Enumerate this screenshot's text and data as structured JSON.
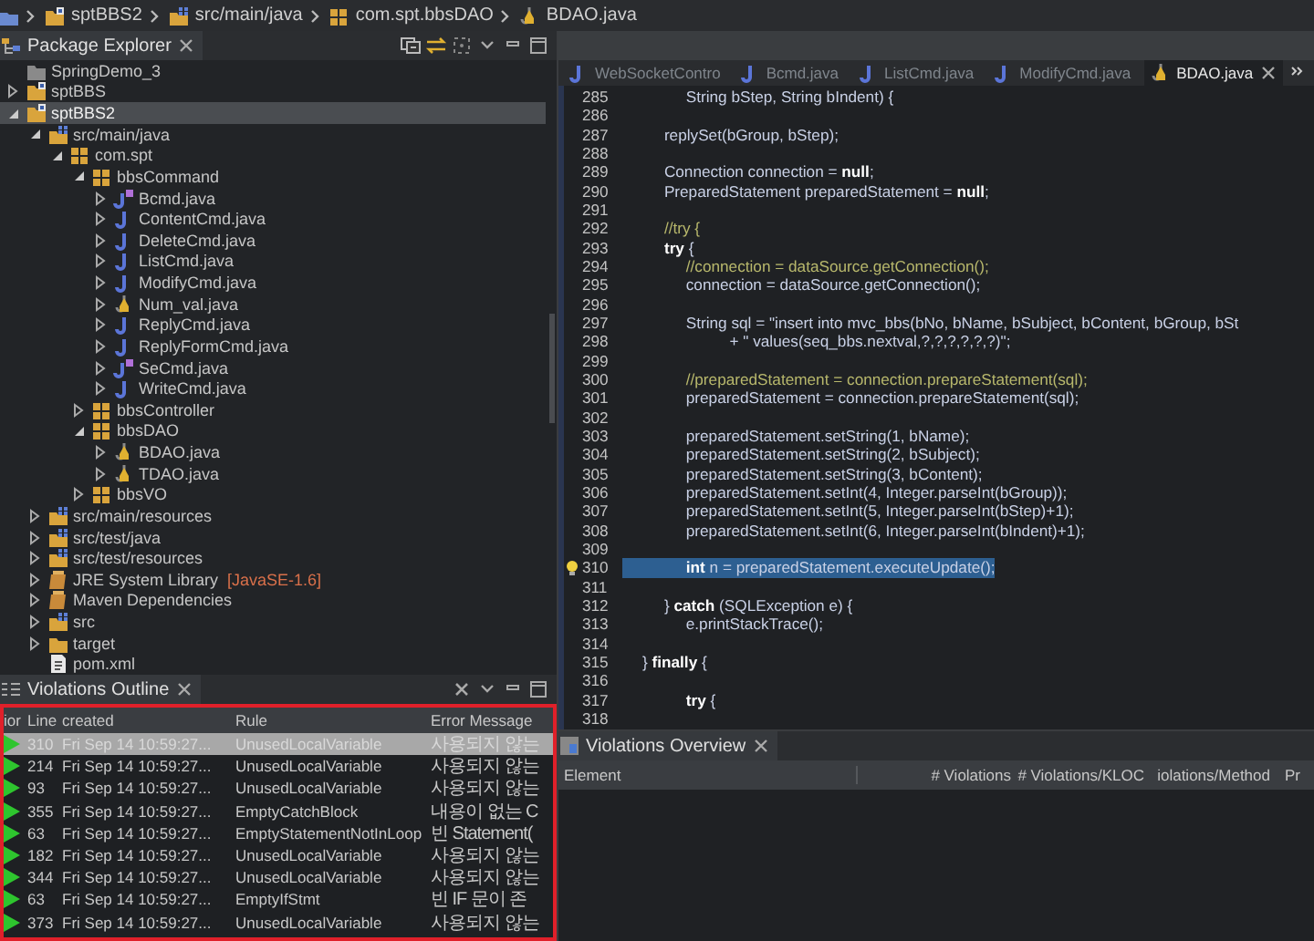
{
  "breadcrumb": [
    {
      "label": "sptBBS2",
      "kind": "project"
    },
    {
      "label": "src/main/java",
      "kind": "source-folder"
    },
    {
      "label": "com.spt.bbsDAO",
      "kind": "package"
    },
    {
      "label": "BDAO.java",
      "kind": "java-warning"
    }
  ],
  "package_explorer": {
    "title": "Package Explorer",
    "tree": [
      {
        "label": "SpringDemo_3",
        "kind": "closed-project",
        "selected": false
      },
      {
        "label": "sptBBS",
        "kind": "project",
        "expanded": false,
        "selected": false
      },
      {
        "label": "sptBBS2",
        "kind": "project",
        "expanded": true,
        "selected": true,
        "children": [
          {
            "label": "src/main/java",
            "kind": "source-folder",
            "expanded": true,
            "selected": false,
            "children": [
              {
                "label": "com.spt",
                "kind": "package",
                "expanded": true,
                "selected": false,
                "children": [
                  {
                    "label": "bbsCommand",
                    "kind": "package",
                    "expanded": true,
                    "selected": false,
                    "children": [
                      {
                        "label": "Bcmd.java",
                        "kind": "java-interface",
                        "expanded": false,
                        "selected": false
                      },
                      {
                        "label": "ContentCmd.java",
                        "kind": "java",
                        "expanded": false,
                        "selected": false
                      },
                      {
                        "label": "DeleteCmd.java",
                        "kind": "java",
                        "expanded": false,
                        "selected": false
                      },
                      {
                        "label": "ListCmd.java",
                        "kind": "java",
                        "expanded": false,
                        "selected": false
                      },
                      {
                        "label": "ModifyCmd.java",
                        "kind": "java",
                        "expanded": false,
                        "selected": false
                      },
                      {
                        "label": "Num_val.java",
                        "kind": "java-warning",
                        "expanded": false,
                        "selected": false
                      },
                      {
                        "label": "ReplyCmd.java",
                        "kind": "java",
                        "expanded": false,
                        "selected": false
                      },
                      {
                        "label": "ReplyFormCmd.java",
                        "kind": "java",
                        "expanded": false,
                        "selected": false
                      },
                      {
                        "label": "SeCmd.java",
                        "kind": "java-interface",
                        "expanded": false,
                        "selected": false
                      },
                      {
                        "label": "WriteCmd.java",
                        "kind": "java",
                        "expanded": false,
                        "selected": false
                      }
                    ]
                  },
                  {
                    "label": "bbsController",
                    "kind": "package",
                    "expanded": false,
                    "selected": false
                  },
                  {
                    "label": "bbsDAO",
                    "kind": "package",
                    "expanded": true,
                    "selected": false,
                    "children": [
                      {
                        "label": "BDAO.java",
                        "kind": "java-warning",
                        "expanded": false,
                        "selected": false
                      },
                      {
                        "label": "TDAO.java",
                        "kind": "java-warning",
                        "expanded": false,
                        "selected": false
                      }
                    ]
                  },
                  {
                    "label": "bbsVO",
                    "kind": "package",
                    "expanded": false,
                    "selected": false
                  }
                ]
              }
            ]
          },
          {
            "label": "src/main/resources",
            "kind": "source-folder",
            "expanded": false,
            "selected": false
          },
          {
            "label": "src/test/java",
            "kind": "source-folder",
            "expanded": false,
            "selected": false
          },
          {
            "label": "src/test/resources",
            "kind": "source-folder",
            "expanded": false,
            "selected": false
          },
          {
            "label": "JRE System Library",
            "decoration": "[JavaSE-1.6]",
            "kind": "library",
            "expanded": false,
            "selected": false
          },
          {
            "label": "Maven Dependencies",
            "kind": "library",
            "expanded": false,
            "selected": false
          },
          {
            "label": "src",
            "kind": "source-folder",
            "expanded": false,
            "selected": false
          },
          {
            "label": "target",
            "kind": "folder",
            "expanded": false,
            "selected": false
          },
          {
            "label": "pom.xml",
            "kind": "file",
            "selected": false
          }
        ]
      }
    ]
  },
  "violations_outline": {
    "title": "Violations Outline",
    "columns": [
      "ior",
      "Line",
      "created",
      "Rule",
      "Error Message"
    ],
    "rows": [
      {
        "selected": true,
        "line": "310",
        "created": "Fri Sep 14 10:59:27...",
        "rule": "UnusedLocalVariable",
        "message": "사용되지 않는"
      },
      {
        "selected": false,
        "line": "214",
        "created": "Fri Sep 14 10:59:27...",
        "rule": "UnusedLocalVariable",
        "message": "사용되지 않는"
      },
      {
        "selected": false,
        "line": "93",
        "created": "Fri Sep 14 10:59:27...",
        "rule": "UnusedLocalVariable",
        "message": "사용되지 않는"
      },
      {
        "selected": false,
        "line": "355",
        "created": "Fri Sep 14 10:59:27...",
        "rule": "EmptyCatchBlock",
        "message": "내용이 없는 C"
      },
      {
        "selected": false,
        "line": "63",
        "created": "Fri Sep 14 10:59:27...",
        "rule": "EmptyStatementNotInLoop",
        "message": "빈 Statement("
      },
      {
        "selected": false,
        "line": "182",
        "created": "Fri Sep 14 10:59:27...",
        "rule": "UnusedLocalVariable",
        "message": "사용되지 않는"
      },
      {
        "selected": false,
        "line": "344",
        "created": "Fri Sep 14 10:59:27...",
        "rule": "UnusedLocalVariable",
        "message": "사용되지 않는"
      },
      {
        "selected": false,
        "line": "63",
        "created": "Fri Sep 14 10:59:27...",
        "rule": "EmptyIfStmt",
        "message": "빈 IF 문이 존"
      },
      {
        "selected": false,
        "line": "373",
        "created": "Fri Sep 14 10:59:27...",
        "rule": "UnusedLocalVariable",
        "message": "사용되지 않는"
      }
    ]
  },
  "editor": {
    "tabs": [
      {
        "label": "WebSocketContro",
        "kind": "java",
        "selected": false
      },
      {
        "label": "Bcmd.java",
        "kind": "java",
        "selected": false
      },
      {
        "label": "ListCmd.java",
        "kind": "java",
        "selected": false
      },
      {
        "label": "ModifyCmd.java",
        "kind": "java",
        "selected": false
      },
      {
        "label": "BDAO.java",
        "kind": "java-warning",
        "selected": true
      }
    ],
    "lines": [
      {
        "n": "285",
        "kind": "code",
        "selected": false,
        "warning": false,
        "text": "          String bStep, String bIndent) {"
      },
      {
        "n": "286",
        "kind": "blank",
        "selected": false,
        "warning": false
      },
      {
        "n": "287",
        "kind": "code",
        "selected": false,
        "warning": false,
        "text": "     replySet(bGroup, bStep);"
      },
      {
        "n": "288",
        "kind": "blank",
        "selected": false,
        "warning": false
      },
      {
        "n": "289",
        "kind": "code",
        "selected": false,
        "warning": false,
        "text": "     Connection connection = **null**;"
      },
      {
        "n": "290",
        "kind": "code",
        "selected": false,
        "warning": false,
        "text": "     PreparedStatement preparedStatement = **null**;"
      },
      {
        "n": "291",
        "kind": "blank",
        "selected": false,
        "warning": false
      },
      {
        "n": "292",
        "kind": "comment",
        "selected": false,
        "warning": false,
        "text": "     //try {"
      },
      {
        "n": "293",
        "kind": "code",
        "selected": false,
        "warning": false,
        "text": "     **try** {"
      },
      {
        "n": "294",
        "kind": "comment",
        "selected": false,
        "warning": false,
        "text": "          //connection = dataSource.getConnection();"
      },
      {
        "n": "295",
        "kind": "code",
        "selected": false,
        "warning": false,
        "text": "          connection = dataSource.getConnection();"
      },
      {
        "n": "296",
        "kind": "blank",
        "selected": false,
        "warning": false
      },
      {
        "n": "297",
        "kind": "code",
        "selected": false,
        "warning": false,
        "text": "          String sql = \"insert into mvc_bbs(bNo, bName, bSubject, bContent, bGroup, bSt"
      },
      {
        "n": "298",
        "kind": "code",
        "selected": false,
        "warning": false,
        "text": "                    + \" values(seq_bbs.nextval,?,?,?,?,?,?)\";"
      },
      {
        "n": "299",
        "kind": "blank",
        "selected": false,
        "warning": false
      },
      {
        "n": "300",
        "kind": "comment",
        "selected": false,
        "warning": false,
        "text": "          //preparedStatement = connection.prepareStatement(sql);"
      },
      {
        "n": "301",
        "kind": "code",
        "selected": false,
        "warning": false,
        "text": "          preparedStatement = connection.prepareStatement(sql);"
      },
      {
        "n": "302",
        "kind": "blank",
        "selected": false,
        "warning": false
      },
      {
        "n": "303",
        "kind": "code",
        "selected": false,
        "warning": false,
        "text": "          preparedStatement.setString(1, bName);"
      },
      {
        "n": "304",
        "kind": "code",
        "selected": false,
        "warning": false,
        "text": "          preparedStatement.setString(2, bSubject);"
      },
      {
        "n": "305",
        "kind": "code",
        "selected": false,
        "warning": false,
        "text": "          preparedStatement.setString(3, bContent);"
      },
      {
        "n": "306",
        "kind": "code",
        "selected": false,
        "warning": false,
        "text": "          preparedStatement.setInt(4, Integer.parseInt(bGroup));"
      },
      {
        "n": "307",
        "kind": "code",
        "selected": false,
        "warning": false,
        "text": "          preparedStatement.setInt(5, Integer.parseInt(bStep)+1);"
      },
      {
        "n": "308",
        "kind": "code",
        "selected": false,
        "warning": false,
        "text": "          preparedStatement.setInt(6, Integer.parseInt(bIndent)+1);"
      },
      {
        "n": "309",
        "kind": "blank",
        "selected": false,
        "warning": false
      },
      {
        "n": "310",
        "kind": "code",
        "selected": true,
        "warning": true,
        "text": "          **int** n = preparedStatement.executeUpdate();"
      },
      {
        "n": "311",
        "kind": "blank",
        "selected": false,
        "warning": false
      },
      {
        "n": "312",
        "kind": "code",
        "selected": false,
        "warning": false,
        "text": "     } **catch** (SQLException e) {"
      },
      {
        "n": "313",
        "kind": "code",
        "selected": false,
        "warning": false,
        "text": "          e.printStackTrace();"
      },
      {
        "n": "314",
        "kind": "blank",
        "selected": false,
        "warning": false
      },
      {
        "n": "315",
        "kind": "code",
        "selected": false,
        "warning": false,
        "text": "} **finally** {"
      },
      {
        "n": "316",
        "kind": "blank",
        "selected": false,
        "warning": false
      },
      {
        "n": "317",
        "kind": "code",
        "selected": false,
        "warning": false,
        "text": "          **try** {"
      },
      {
        "n": "318",
        "kind": "blank",
        "selected": false,
        "warning": false
      }
    ]
  },
  "violations_overview": {
    "title": "Violations Overview",
    "columns": [
      "Element",
      "# Violations",
      "# Violations/KLOC",
      "iolations/Method",
      "Pr"
    ]
  }
}
